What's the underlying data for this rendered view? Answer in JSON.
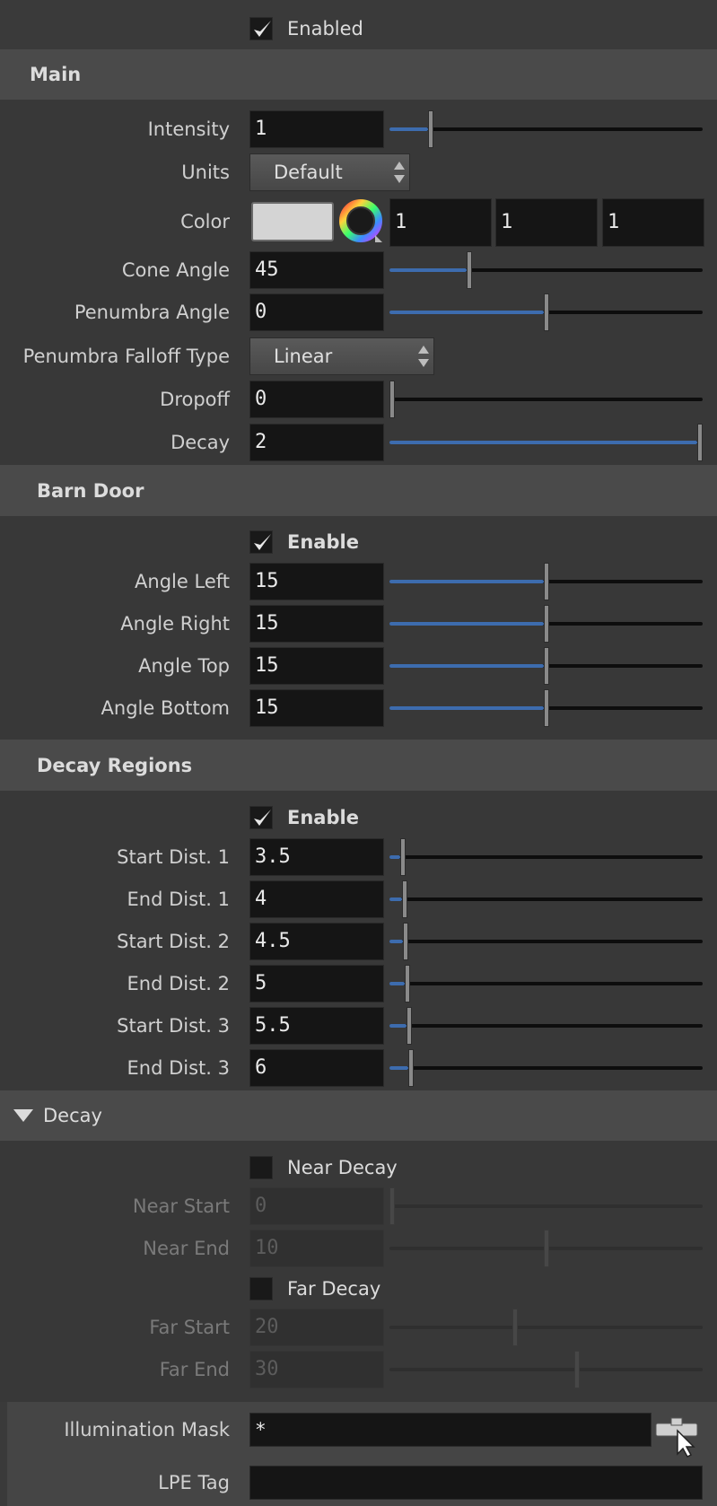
{
  "top": {
    "enabled_label": "Enabled"
  },
  "main": {
    "title": "Main",
    "intensity": {
      "label": "Intensity",
      "value": "1",
      "slider": 0.125
    },
    "units": {
      "label": "Units",
      "value": "Default"
    },
    "color": {
      "label": "Color",
      "r": "1",
      "g": "1",
      "b": "1",
      "swatch": "#d4d4d4"
    },
    "cone_angle": {
      "label": "Cone Angle",
      "value": "45",
      "slider": 0.25
    },
    "penumbra_angle": {
      "label": "Penumbra Angle",
      "value": "0",
      "slider": 0.5
    },
    "penumbra_falloff": {
      "label": "Penumbra Falloff Type",
      "value": "Linear"
    },
    "dropoff": {
      "label": "Dropoff",
      "value": "0",
      "slider": 0.0
    },
    "decay": {
      "label": "Decay",
      "value": "2",
      "slider": 1.0
    }
  },
  "barn_door": {
    "title": "Barn Door",
    "enable_label": "Enable",
    "angle_left": {
      "label": "Angle Left",
      "value": "15",
      "slider": 0.5
    },
    "angle_right": {
      "label": "Angle Right",
      "value": "15",
      "slider": 0.5
    },
    "angle_top": {
      "label": "Angle Top",
      "value": "15",
      "slider": 0.5
    },
    "angle_bottom": {
      "label": "Angle Bottom",
      "value": "15",
      "slider": 0.5
    }
  },
  "decay_regions": {
    "title": "Decay Regions",
    "enable_label": "Enable",
    "start1": {
      "label": "Start Dist. 1",
      "value": "3.5",
      "slider": 0.035
    },
    "end1": {
      "label": "End Dist. 1",
      "value": "4",
      "slider": 0.04
    },
    "start2": {
      "label": "Start Dist. 2",
      "value": "4.5",
      "slider": 0.045
    },
    "end2": {
      "label": "End Dist. 2",
      "value": "5",
      "slider": 0.05
    },
    "start3": {
      "label": "Start Dist. 3",
      "value": "5.5",
      "slider": 0.055
    },
    "end3": {
      "label": "End Dist. 3",
      "value": "6",
      "slider": 0.06
    }
  },
  "decay": {
    "title": "Decay",
    "near_decay_label": "Near Decay",
    "near_start": {
      "label": "Near Start",
      "value": "0",
      "slider": 0.0
    },
    "near_end": {
      "label": "Near End",
      "value": "10",
      "slider": 0.5
    },
    "far_decay_label": "Far Decay",
    "far_start": {
      "label": "Far Start",
      "value": "20",
      "slider": 0.4
    },
    "far_end": {
      "label": "Far End",
      "value": "30",
      "slider": 0.6
    }
  },
  "bottom": {
    "illumination_mask": {
      "label": "Illumination Mask",
      "value": "*"
    },
    "lpe_tag": {
      "label": "LPE Tag",
      "value": ""
    }
  },
  "colors": {
    "accent": "#3d6cae",
    "header_bg": "#4a4a4a",
    "panel_bg": "#383838"
  }
}
